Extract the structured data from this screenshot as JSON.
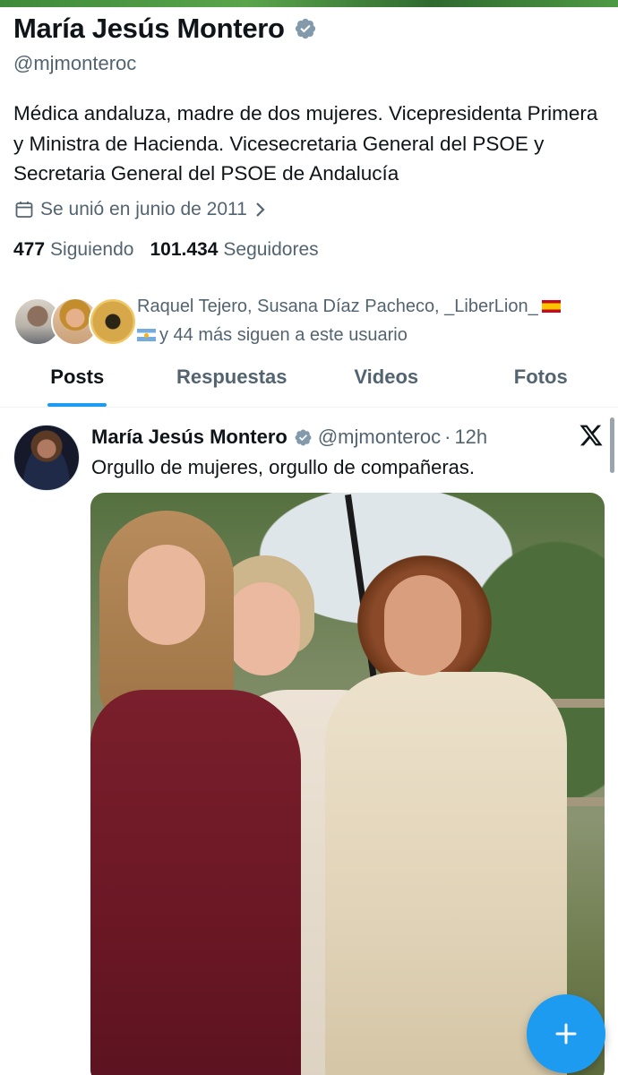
{
  "profile": {
    "display_name": "María Jesús Montero",
    "handle": "@mjmonteroc",
    "bio": "Médica andaluza, madre de dos mujeres. Vicepresidenta Primera y Ministra de Hacienda. Vicesecretaria General del PSOE y Secretaria General del PSOE de Andalucía",
    "joined": "Se unió en junio de 2011",
    "following_count": "477",
    "following_label": "Siguiendo",
    "followers_count": "101.434",
    "followers_label": "Seguidores"
  },
  "followers_you_know": {
    "line1": "Raquel Tejero, Susana Díaz Pacheco, _LiberLion_",
    "line2": "y 44 más siguen a este usuario"
  },
  "tabs": [
    {
      "label": "Posts",
      "active": true
    },
    {
      "label": "Respuestas",
      "active": false
    },
    {
      "label": "Videos",
      "active": false
    },
    {
      "label": "Fotos",
      "active": false
    }
  ],
  "tweet": {
    "author_name": "María Jesús Montero",
    "author_handle": "@mjmonteroc",
    "separator": "·",
    "time": "12h",
    "text": "Orgullo de mujeres, orgullo de compañeras."
  },
  "colors": {
    "accent": "#1d9bf0",
    "text_primary": "#0f1419",
    "text_secondary": "#536471"
  },
  "icons": [
    "verified-badge-icon",
    "calendar-icon",
    "chevron-right-icon",
    "x-logo-icon",
    "plus-icon"
  ]
}
